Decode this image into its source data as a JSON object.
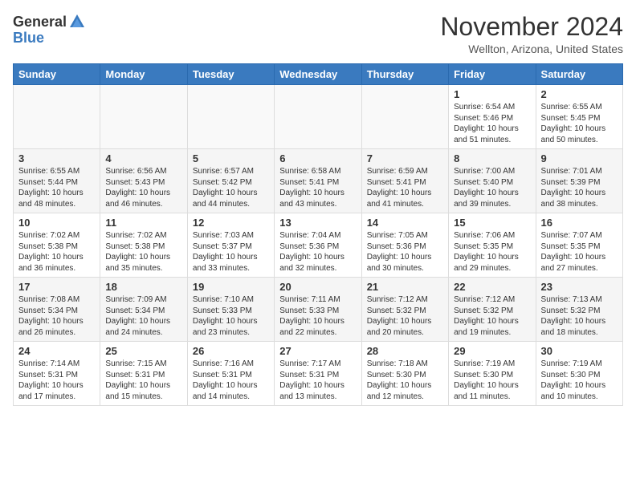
{
  "header": {
    "logo_general": "General",
    "logo_blue": "Blue",
    "month_title": "November 2024",
    "location": "Wellton, Arizona, United States"
  },
  "calendar": {
    "days_of_week": [
      "Sunday",
      "Monday",
      "Tuesday",
      "Wednesday",
      "Thursday",
      "Friday",
      "Saturday"
    ],
    "weeks": [
      [
        {
          "day": "",
          "detail": ""
        },
        {
          "day": "",
          "detail": ""
        },
        {
          "day": "",
          "detail": ""
        },
        {
          "day": "",
          "detail": ""
        },
        {
          "day": "",
          "detail": ""
        },
        {
          "day": "1",
          "detail": "Sunrise: 6:54 AM\nSunset: 5:46 PM\nDaylight: 10 hours\nand 51 minutes."
        },
        {
          "day": "2",
          "detail": "Sunrise: 6:55 AM\nSunset: 5:45 PM\nDaylight: 10 hours\nand 50 minutes."
        }
      ],
      [
        {
          "day": "3",
          "detail": "Sunrise: 6:55 AM\nSunset: 5:44 PM\nDaylight: 10 hours\nand 48 minutes."
        },
        {
          "day": "4",
          "detail": "Sunrise: 6:56 AM\nSunset: 5:43 PM\nDaylight: 10 hours\nand 46 minutes."
        },
        {
          "day": "5",
          "detail": "Sunrise: 6:57 AM\nSunset: 5:42 PM\nDaylight: 10 hours\nand 44 minutes."
        },
        {
          "day": "6",
          "detail": "Sunrise: 6:58 AM\nSunset: 5:41 PM\nDaylight: 10 hours\nand 43 minutes."
        },
        {
          "day": "7",
          "detail": "Sunrise: 6:59 AM\nSunset: 5:41 PM\nDaylight: 10 hours\nand 41 minutes."
        },
        {
          "day": "8",
          "detail": "Sunrise: 7:00 AM\nSunset: 5:40 PM\nDaylight: 10 hours\nand 39 minutes."
        },
        {
          "day": "9",
          "detail": "Sunrise: 7:01 AM\nSunset: 5:39 PM\nDaylight: 10 hours\nand 38 minutes."
        }
      ],
      [
        {
          "day": "10",
          "detail": "Sunrise: 7:02 AM\nSunset: 5:38 PM\nDaylight: 10 hours\nand 36 minutes."
        },
        {
          "day": "11",
          "detail": "Sunrise: 7:02 AM\nSunset: 5:38 PM\nDaylight: 10 hours\nand 35 minutes."
        },
        {
          "day": "12",
          "detail": "Sunrise: 7:03 AM\nSunset: 5:37 PM\nDaylight: 10 hours\nand 33 minutes."
        },
        {
          "day": "13",
          "detail": "Sunrise: 7:04 AM\nSunset: 5:36 PM\nDaylight: 10 hours\nand 32 minutes."
        },
        {
          "day": "14",
          "detail": "Sunrise: 7:05 AM\nSunset: 5:36 PM\nDaylight: 10 hours\nand 30 minutes."
        },
        {
          "day": "15",
          "detail": "Sunrise: 7:06 AM\nSunset: 5:35 PM\nDaylight: 10 hours\nand 29 minutes."
        },
        {
          "day": "16",
          "detail": "Sunrise: 7:07 AM\nSunset: 5:35 PM\nDaylight: 10 hours\nand 27 minutes."
        }
      ],
      [
        {
          "day": "17",
          "detail": "Sunrise: 7:08 AM\nSunset: 5:34 PM\nDaylight: 10 hours\nand 26 minutes."
        },
        {
          "day": "18",
          "detail": "Sunrise: 7:09 AM\nSunset: 5:34 PM\nDaylight: 10 hours\nand 24 minutes."
        },
        {
          "day": "19",
          "detail": "Sunrise: 7:10 AM\nSunset: 5:33 PM\nDaylight: 10 hours\nand 23 minutes."
        },
        {
          "day": "20",
          "detail": "Sunrise: 7:11 AM\nSunset: 5:33 PM\nDaylight: 10 hours\nand 22 minutes."
        },
        {
          "day": "21",
          "detail": "Sunrise: 7:12 AM\nSunset: 5:32 PM\nDaylight: 10 hours\nand 20 minutes."
        },
        {
          "day": "22",
          "detail": "Sunrise: 7:12 AM\nSunset: 5:32 PM\nDaylight: 10 hours\nand 19 minutes."
        },
        {
          "day": "23",
          "detail": "Sunrise: 7:13 AM\nSunset: 5:32 PM\nDaylight: 10 hours\nand 18 minutes."
        }
      ],
      [
        {
          "day": "24",
          "detail": "Sunrise: 7:14 AM\nSunset: 5:31 PM\nDaylight: 10 hours\nand 17 minutes."
        },
        {
          "day": "25",
          "detail": "Sunrise: 7:15 AM\nSunset: 5:31 PM\nDaylight: 10 hours\nand 15 minutes."
        },
        {
          "day": "26",
          "detail": "Sunrise: 7:16 AM\nSunset: 5:31 PM\nDaylight: 10 hours\nand 14 minutes."
        },
        {
          "day": "27",
          "detail": "Sunrise: 7:17 AM\nSunset: 5:31 PM\nDaylight: 10 hours\nand 13 minutes."
        },
        {
          "day": "28",
          "detail": "Sunrise: 7:18 AM\nSunset: 5:30 PM\nDaylight: 10 hours\nand 12 minutes."
        },
        {
          "day": "29",
          "detail": "Sunrise: 7:19 AM\nSunset: 5:30 PM\nDaylight: 10 hours\nand 11 minutes."
        },
        {
          "day": "30",
          "detail": "Sunrise: 7:19 AM\nSunset: 5:30 PM\nDaylight: 10 hours\nand 10 minutes."
        }
      ]
    ]
  }
}
